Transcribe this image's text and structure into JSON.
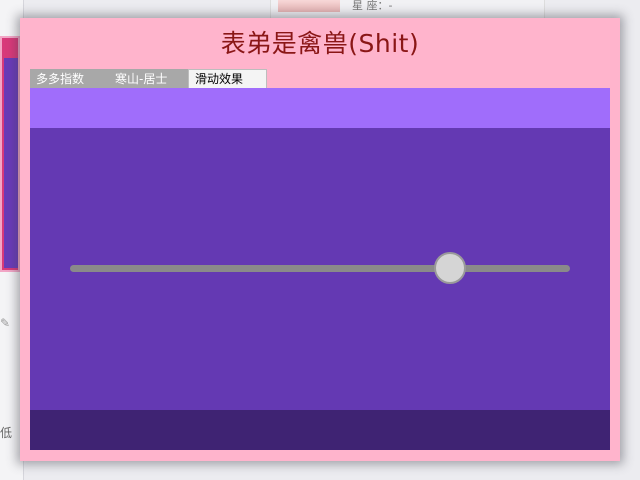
{
  "background": {
    "top_text": "星 座：-",
    "left_note": "低",
    "left_icon": "edit-icon"
  },
  "window": {
    "title": "表弟是禽兽(Shit)",
    "tabs": [
      {
        "label": "多多指数",
        "active": false
      },
      {
        "label": "寒山-居士",
        "active": false
      },
      {
        "label": "滑动效果",
        "active": true
      }
    ]
  },
  "slider": {
    "value_fraction": 0.76
  },
  "colors": {
    "window_bg": "#ffb4cc",
    "title_text": "#8a1616",
    "content_main": "#6439b3",
    "content_top": "#a06dfb",
    "content_bottom": "#3f2373",
    "track": "#8a8a8a",
    "thumb": "#d5d5d5"
  }
}
